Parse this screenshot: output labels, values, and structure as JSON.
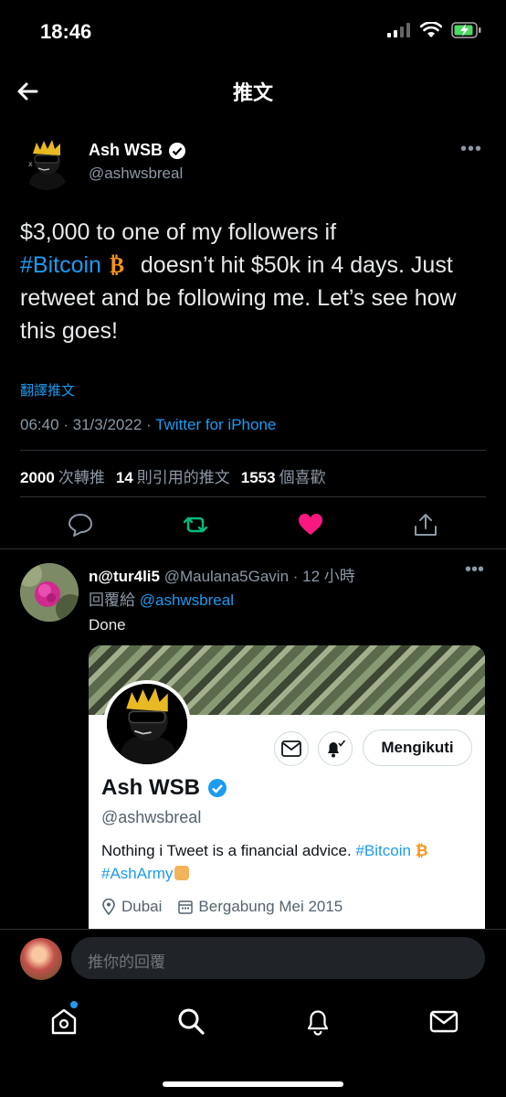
{
  "status_bar": {
    "time": "18:46"
  },
  "nav": {
    "title": "推文"
  },
  "tweet": {
    "author_name": "Ash WSB",
    "author_handle": "@ashwsbreal",
    "text_part1": "$3,000 to one of my followers if",
    "hashtag": "#Bitcoin",
    "text_part2": "doesn’t hit $50k in 4 days. Just retweet and be following me. Let’s see how this goes!",
    "translate": "翻譯推文",
    "meta_time": "06:40 · 31/3/2022 · ",
    "meta_source": "Twitter for iPhone",
    "stats": {
      "retweets_count": "2000",
      "retweets_label": "次轉推",
      "quotes_count": "14",
      "quotes_label": "則引用的推文",
      "likes_count": "1553",
      "likes_label": "個喜歡"
    }
  },
  "reply": {
    "name": "n@tur4li5",
    "handle_time": " @Maulana5Gavin · 12 小時",
    "reply_to_label": "回覆給 ",
    "reply_to_handle": "@ashwsbreal",
    "body": "Done",
    "card": {
      "follow_label": "Mengikuti",
      "name": "Ash WSB",
      "handle": "@ashwsbreal",
      "bio_text": "Nothing i Tweet is a financial advice. ",
      "bio_tag1": "#Bitcoin",
      "bio_tag2": "#AshArmy",
      "location": "Dubai",
      "joined": "Bergabung Mei 2015"
    }
  },
  "composer": {
    "placeholder": "推你的回覆"
  },
  "colors": {
    "accent": "#1d9bf0",
    "like": "#f91880",
    "retweet": "#00ba7c",
    "bitcoin": "#f7931a"
  }
}
